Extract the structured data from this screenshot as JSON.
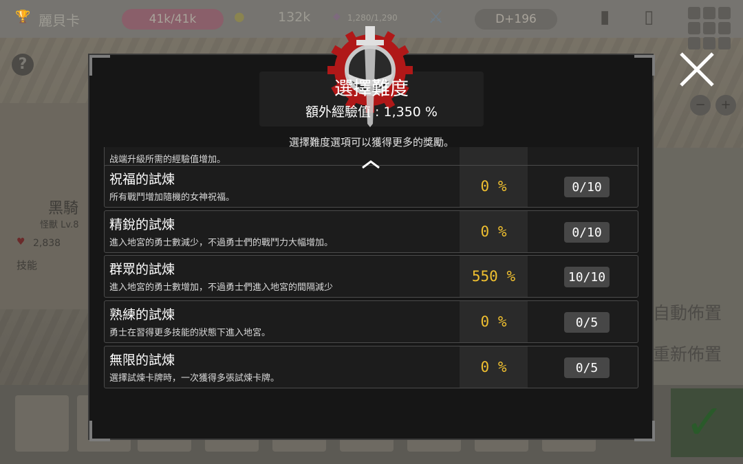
{
  "colors": {
    "accent": "#f0c030",
    "panel": "#161616",
    "row_bg": "#1c1c1c",
    "badge": "#474747",
    "emblem_red": "#b01818"
  },
  "background": {
    "player_name": "麗貝卡",
    "hp": "41k/41k",
    "gold": "132k",
    "essence": "1,280/1,290",
    "day": "D+196",
    "monster_name": "黑騎",
    "monster_level": "怪獸 Lv.8",
    "monster_hp": "2,838",
    "skill_label": "技能",
    "auto_place": "自動佈置",
    "reset_place": "重新佈置"
  },
  "dialog": {
    "title": "選擇難度",
    "bonus_label": "額外經驗值 : 1,350 %",
    "subtitle": "選擇難度選項可以獲得更多的獎勵。",
    "partial_row_text": "战端升級所需的經驗值增加。",
    "trials": [
      {
        "name": "祝福的試煉",
        "desc": "所有戰鬥增加隨機的女神祝福。",
        "pct": "0 %",
        "count": "0/10"
      },
      {
        "name": "精銳的試煉",
        "desc": "進入地宮的勇士數減少，不過勇士們的戰鬥力大幅增加。",
        "pct": "0 %",
        "count": "0/10"
      },
      {
        "name": "群眾的試煉",
        "desc": "進入地宮的勇士數增加，不過勇士們進入地宮的間隔減少",
        "pct": "550 %",
        "count": "10/10"
      },
      {
        "name": "熟練的試煉",
        "desc": "勇士在習得更多技能的狀態下進入地宮。",
        "pct": "0 %",
        "count": "0/5"
      },
      {
        "name": "無限的試煉",
        "desc": "選擇試煉卡牌時，一次獲得多張試煉卡牌。",
        "pct": "0 %",
        "count": "0/5"
      }
    ]
  }
}
